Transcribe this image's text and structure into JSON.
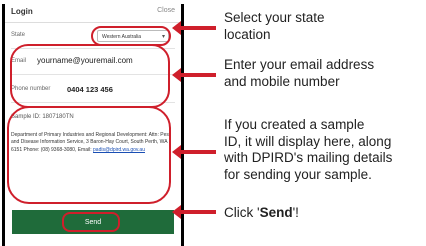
{
  "login": {
    "title": "Login",
    "close_label": "Close"
  },
  "form": {
    "state_label": "State",
    "state_value": "Western Australia",
    "email_label": "Email",
    "email_value": "yourname@youremail.com",
    "phone_label": "Phone number",
    "phone_value": "0404 123 456",
    "sample_id": "Sample ID: 1807180TN",
    "dept_text": "Department of Primary Industries and Regional Development: Attn: Pest and Disease Information Service, 3 Baron-Hay Court, South Perth, WA 6151 Phone: (08) 9368-3080, Email:",
    "dept_email": "padis@dpird.wa.gov.au",
    "send_label": "Send"
  },
  "annotations": {
    "state_note_1": "Select your state",
    "state_note_2": "location",
    "contact_note_1": "Enter your email address",
    "contact_note_2": "and mobile number",
    "sample_note_1": "If you created a sample",
    "sample_note_2": "ID, it will display here, along",
    "sample_note_3": "with DPIRD's mailing details",
    "sample_note_4": "for sending your sample.",
    "send_note_prefix": "Click '",
    "send_note_bold": "Send",
    "send_note_suffix": "'!"
  },
  "colors": {
    "highlight": "#cf1f2b",
    "send_button": "#1f6b3a",
    "link": "#1a4fb4"
  }
}
